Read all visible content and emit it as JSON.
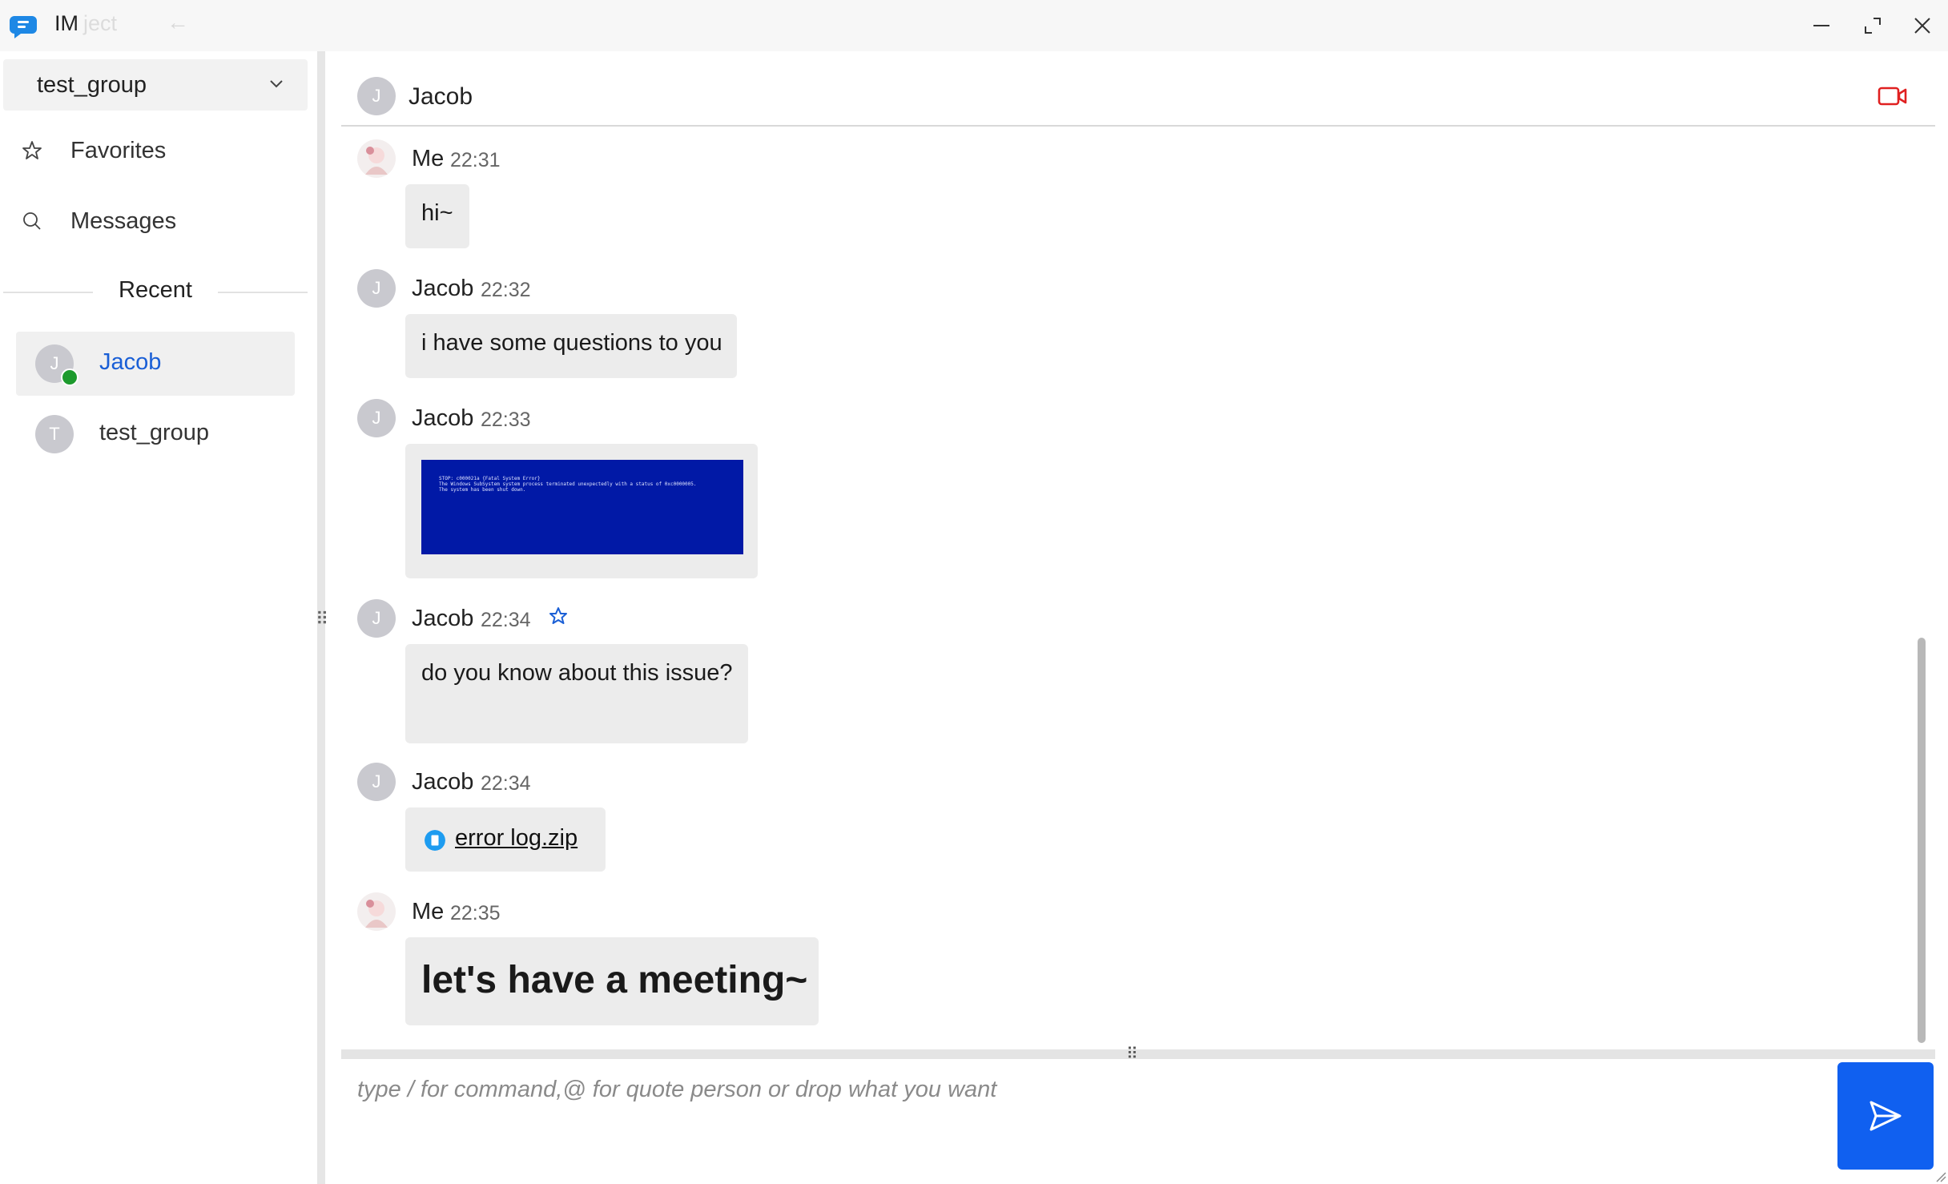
{
  "app": {
    "title": "IM",
    "title_ghost": "ject",
    "back_icon": "arrow-left-icon"
  },
  "window_controls": {
    "minimize": "minimize-icon",
    "maximize": "maximize-icon",
    "close": "close-icon"
  },
  "sidebar": {
    "workspace": "test_group",
    "nav": [
      {
        "label": "Favorites",
        "icon": "star-icon"
      },
      {
        "label": "Messages",
        "icon": "search-icon"
      }
    ],
    "recent_label": "Recent",
    "contacts": [
      {
        "name": "Jacob",
        "initial": "J",
        "online": true,
        "active": true
      },
      {
        "name": "test_group",
        "initial": "T",
        "online": false,
        "active": false
      }
    ]
  },
  "chat": {
    "header": {
      "name": "Jacob",
      "initial": "J",
      "action_icon": "video-call-icon"
    },
    "messages": [
      {
        "sender": "Me",
        "time": "22:31",
        "type": "text",
        "text": "hi~"
      },
      {
        "sender": "Jacob",
        "initial": "J",
        "time": "22:32",
        "type": "text",
        "text": "i have some questions to you"
      },
      {
        "sender": "Jacob",
        "initial": "J",
        "time": "22:33",
        "type": "image",
        "image_lines": [
          "STOP: c000021a {Fatal System Error}",
          "The Windows SubSystem system process terminated unexpectedly with a status of 0xc0000005.",
          "The system has been shut down."
        ]
      },
      {
        "sender": "Jacob",
        "initial": "J",
        "time": "22:34",
        "type": "text",
        "text": "do you know about this issue?",
        "starred": true
      },
      {
        "sender": "Jacob",
        "initial": "J",
        "time": "22:34",
        "type": "file",
        "file_name": "error log.zip"
      },
      {
        "sender": "Me",
        "time": "22:35",
        "type": "text",
        "text": "let's have a meeting~",
        "big": true
      }
    ]
  },
  "composer": {
    "placeholder": "type / for command,@ for quote person or drop what you want",
    "send_icon": "send-icon"
  },
  "colors": {
    "accent": "#1060f0",
    "online": "#1d9a2d",
    "video": "#e02020",
    "active_contact": "#1a5fd6"
  }
}
